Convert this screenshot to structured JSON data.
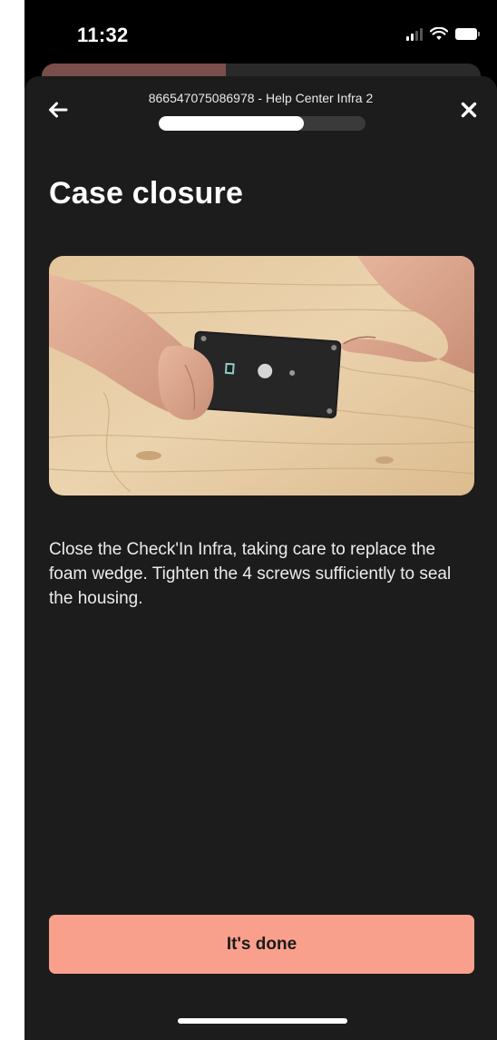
{
  "status_bar": {
    "time": "11:32",
    "icons": [
      "signal-icon",
      "wifi-icon",
      "battery-icon"
    ]
  },
  "back_sheet_progress": 0.42,
  "header": {
    "title": "866547075086978 - Help Center Infra 2",
    "back_icon": "arrow-left-icon",
    "close_icon": "close-icon",
    "progress": 0.7
  },
  "page": {
    "title": "Case closure",
    "image_icon": "device-photo",
    "instructions": "Close the Check'In Infra, taking care to replace the foam wedge. Tighten the 4 screws sufficiently to seal the housing."
  },
  "actions": {
    "done_label": "It's done"
  },
  "colors": {
    "background": "#1c1c1c",
    "accent": "#f9a08d",
    "progress_track": "#3a3a3a"
  }
}
